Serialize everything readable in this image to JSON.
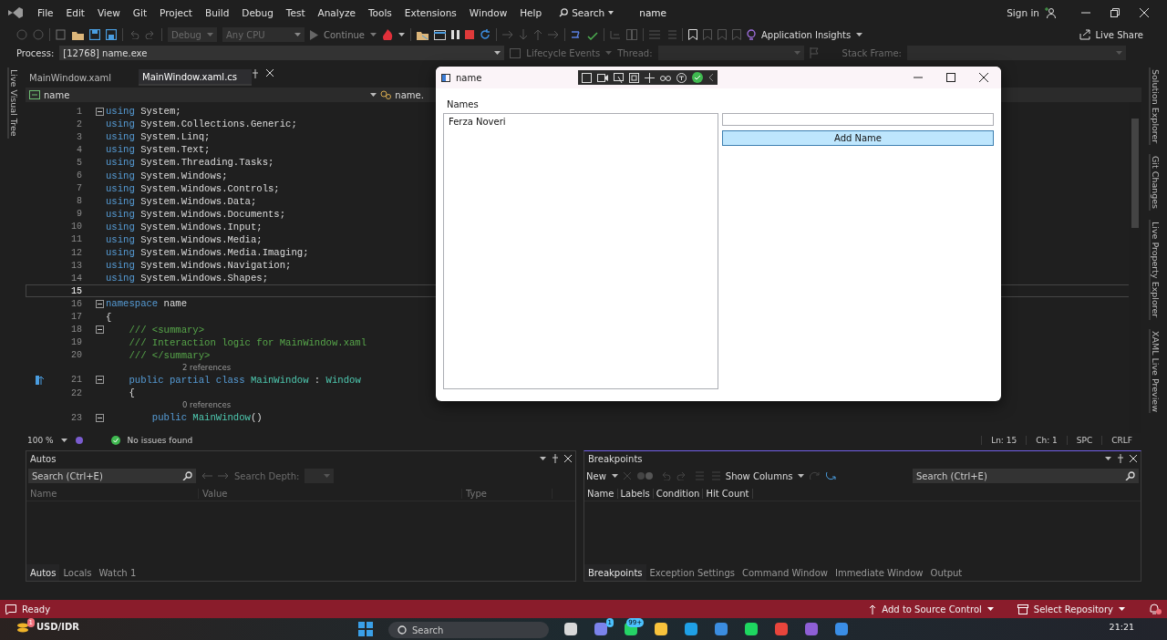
{
  "menu": [
    "File",
    "Edit",
    "View",
    "Git",
    "Project",
    "Build",
    "Debug",
    "Test",
    "Analyze",
    "Tools",
    "Extensions",
    "Window",
    "Help"
  ],
  "search": {
    "label": "Search"
  },
  "solution_name": "name",
  "sign_in": "Sign in",
  "toolbar": {
    "configuration": {
      "value": "Debug",
      "disabled": true
    },
    "platform": {
      "value": "Any CPU",
      "disabled": true
    },
    "continue": {
      "label": "Continue",
      "disabled": true
    },
    "insights": "Application Insights",
    "live_share": "Live Share"
  },
  "debug_bar": {
    "process_label": "Process:",
    "process": "[12768] name.exe",
    "lifecycle": "Lifecycle Events",
    "thread_label": "Thread:",
    "stack_frame_label": "Stack Frame:"
  },
  "left_tool_tabs": [
    "Live Visual Tree"
  ],
  "right_tool_tabs": [
    "Solution Explorer",
    "Git Changes",
    "Live Property Explorer",
    "XAML Live Preview"
  ],
  "editor": {
    "tabs": [
      {
        "label": "MainWindow.xaml",
        "selected": false
      },
      {
        "label": "MainWindow.xaml.cs",
        "selected": true
      }
    ],
    "nav": {
      "project": "name",
      "type": "name."
    },
    "lines": [
      {
        "kind": "code",
        "number": "1",
        "fold": true,
        "current": false,
        "segments": [
          {
            "kind": "keyword",
            "text": "using"
          },
          {
            "kind": "plain",
            "text": " System;"
          }
        ]
      },
      {
        "kind": "code",
        "number": "2",
        "fold": false,
        "current": false,
        "segments": [
          {
            "kind": "keyword",
            "text": "using"
          },
          {
            "kind": "plain",
            "text": " System.Collections.Generic;"
          }
        ]
      },
      {
        "kind": "code",
        "number": "3",
        "fold": false,
        "current": false,
        "segments": [
          {
            "kind": "keyword",
            "text": "using"
          },
          {
            "kind": "plain",
            "text": " System.Linq;"
          }
        ]
      },
      {
        "kind": "code",
        "number": "4",
        "fold": false,
        "current": false,
        "segments": [
          {
            "kind": "keyword",
            "text": "using"
          },
          {
            "kind": "plain",
            "text": " System.Text;"
          }
        ]
      },
      {
        "kind": "code",
        "number": "5",
        "fold": false,
        "current": false,
        "segments": [
          {
            "kind": "keyword",
            "text": "using"
          },
          {
            "kind": "plain",
            "text": " System.Threading.Tasks;"
          }
        ]
      },
      {
        "kind": "code",
        "number": "6",
        "fold": false,
        "current": false,
        "segments": [
          {
            "kind": "keyword",
            "text": "using"
          },
          {
            "kind": "plain",
            "text": " System.Windows;"
          }
        ]
      },
      {
        "kind": "code",
        "number": "7",
        "fold": false,
        "current": false,
        "segments": [
          {
            "kind": "keyword",
            "text": "using"
          },
          {
            "kind": "plain",
            "text": " System.Windows.Controls;"
          }
        ]
      },
      {
        "kind": "code",
        "number": "8",
        "fold": false,
        "current": false,
        "segments": [
          {
            "kind": "keyword",
            "text": "using"
          },
          {
            "kind": "plain",
            "text": " System.Windows.Data;"
          }
        ]
      },
      {
        "kind": "code",
        "number": "9",
        "fold": false,
        "current": false,
        "segments": [
          {
            "kind": "keyword",
            "text": "using"
          },
          {
            "kind": "plain",
            "text": " System.Windows.Documents;"
          }
        ]
      },
      {
        "kind": "code",
        "number": "10",
        "fold": false,
        "current": false,
        "segments": [
          {
            "kind": "keyword",
            "text": "using"
          },
          {
            "kind": "plain",
            "text": " System.Windows.Input;"
          }
        ]
      },
      {
        "kind": "code",
        "number": "11",
        "fold": false,
        "current": false,
        "segments": [
          {
            "kind": "keyword",
            "text": "using"
          },
          {
            "kind": "plain",
            "text": " System.Windows.Media;"
          }
        ]
      },
      {
        "kind": "code",
        "number": "12",
        "fold": false,
        "current": false,
        "segments": [
          {
            "kind": "keyword",
            "text": "using"
          },
          {
            "kind": "plain",
            "text": " System.Windows.Media.Imaging;"
          }
        ]
      },
      {
        "kind": "code",
        "number": "13",
        "fold": false,
        "current": false,
        "segments": [
          {
            "kind": "keyword",
            "text": "using"
          },
          {
            "kind": "plain",
            "text": " System.Windows.Navigation;"
          }
        ]
      },
      {
        "kind": "code",
        "number": "14",
        "fold": false,
        "current": false,
        "segments": [
          {
            "kind": "keyword",
            "text": "using"
          },
          {
            "kind": "plain",
            "text": " System.Windows.Shapes;"
          }
        ]
      },
      {
        "kind": "code",
        "number": "15",
        "fold": false,
        "current": true
      },
      {
        "kind": "code",
        "number": "16",
        "fold": true,
        "current": false,
        "segments": [
          {
            "kind": "keyword",
            "text": "namespace"
          },
          {
            "kind": "plain",
            "text": " name"
          }
        ]
      },
      {
        "kind": "code",
        "number": "17",
        "fold": false,
        "current": false,
        "segments": [
          {
            "kind": "plain",
            "text": "{"
          }
        ]
      },
      {
        "kind": "code",
        "number": "18",
        "fold": true,
        "current": false,
        "segments": [
          {
            "kind": "comment",
            "text": "    /// <summary>"
          }
        ]
      },
      {
        "kind": "code",
        "number": "19",
        "fold": false,
        "current": false,
        "segments": [
          {
            "kind": "comment",
            "text": "    /// Interaction logic for MainWindow.xaml"
          }
        ]
      },
      {
        "kind": "code",
        "number": "20",
        "fold": false,
        "current": false,
        "segments": [
          {
            "kind": "comment",
            "text": "    /// </summary>"
          }
        ]
      },
      {
        "kind": "codelens",
        "text": "2 references"
      },
      {
        "kind": "code",
        "number": "21",
        "fold": true,
        "current": false,
        "marker": true,
        "segments": [
          {
            "kind": "keyword",
            "text": "    public partial class"
          },
          {
            "kind": "type",
            "text": " MainWindow"
          },
          {
            "kind": "plain",
            "text": " : "
          },
          {
            "kind": "type",
            "text": "Window"
          }
        ]
      },
      {
        "kind": "code",
        "number": "22",
        "fold": false,
        "current": false,
        "segments": [
          {
            "kind": "plain",
            "text": "    {"
          }
        ]
      },
      {
        "kind": "codelens",
        "text": "0 references"
      },
      {
        "kind": "code",
        "number": "23",
        "fold": true,
        "current": false,
        "segments": [
          {
            "kind": "keyword",
            "text": "        public"
          },
          {
            "kind": "type",
            "text": " MainWindow"
          },
          {
            "kind": "plain",
            "text": "()"
          }
        ]
      }
    ],
    "status": {
      "zoom": "100 %",
      "issues": "No issues found",
      "line": "Ln: 15",
      "column": "Ch: 1",
      "indent": "SPC",
      "line_ending": "CRLF"
    }
  },
  "app_window": {
    "title": "name",
    "label": "Names",
    "names": [
      {
        "text": "Ferza Noveri",
        "selected": false
      }
    ],
    "add_button": "Add Name"
  },
  "autos": {
    "title": "Autos",
    "search": {
      "placeholder": "Search (Ctrl+E)"
    },
    "depth_label": "Search Depth:",
    "columns": [
      "Name",
      "Value",
      "Type"
    ],
    "tabs": [
      {
        "label": "Autos",
        "selected": true
      },
      {
        "label": "Locals",
        "selected": false
      },
      {
        "label": "Watch 1",
        "selected": false
      }
    ]
  },
  "breakpoints": {
    "title": "Breakpoints",
    "new": "New",
    "show_columns": "Show Columns",
    "search": {
      "placeholder": "Search (Ctrl+E)"
    },
    "columns": [
      "Name",
      "Labels",
      "Condition",
      "Hit Count"
    ],
    "tabs": [
      {
        "label": "Breakpoints",
        "selected": true
      },
      {
        "label": "Exception Settings",
        "selected": false
      },
      {
        "label": "Command Window",
        "selected": false
      },
      {
        "label": "Immediate Window",
        "selected": false
      },
      {
        "label": "Output",
        "selected": false
      }
    ]
  },
  "status_bar": {
    "message": "Ready",
    "source_control": "Add to Source Control",
    "repository": "Select Repository"
  },
  "taskbar": {
    "widget": {
      "label": "USD/IDR",
      "badge": "1"
    },
    "search": {
      "placeholder": "Search"
    },
    "apps": [
      {
        "kind": "taskview"
      },
      {
        "kind": "chat",
        "badge": "1"
      },
      {
        "kind": "messenger",
        "badge": "99+"
      },
      {
        "kind": "folder"
      },
      {
        "kind": "browser"
      },
      {
        "kind": "store"
      },
      {
        "kind": "music"
      },
      {
        "kind": "chrome"
      },
      {
        "kind": "studio"
      },
      {
        "kind": "window"
      }
    ],
    "clock": "21:21"
  }
}
